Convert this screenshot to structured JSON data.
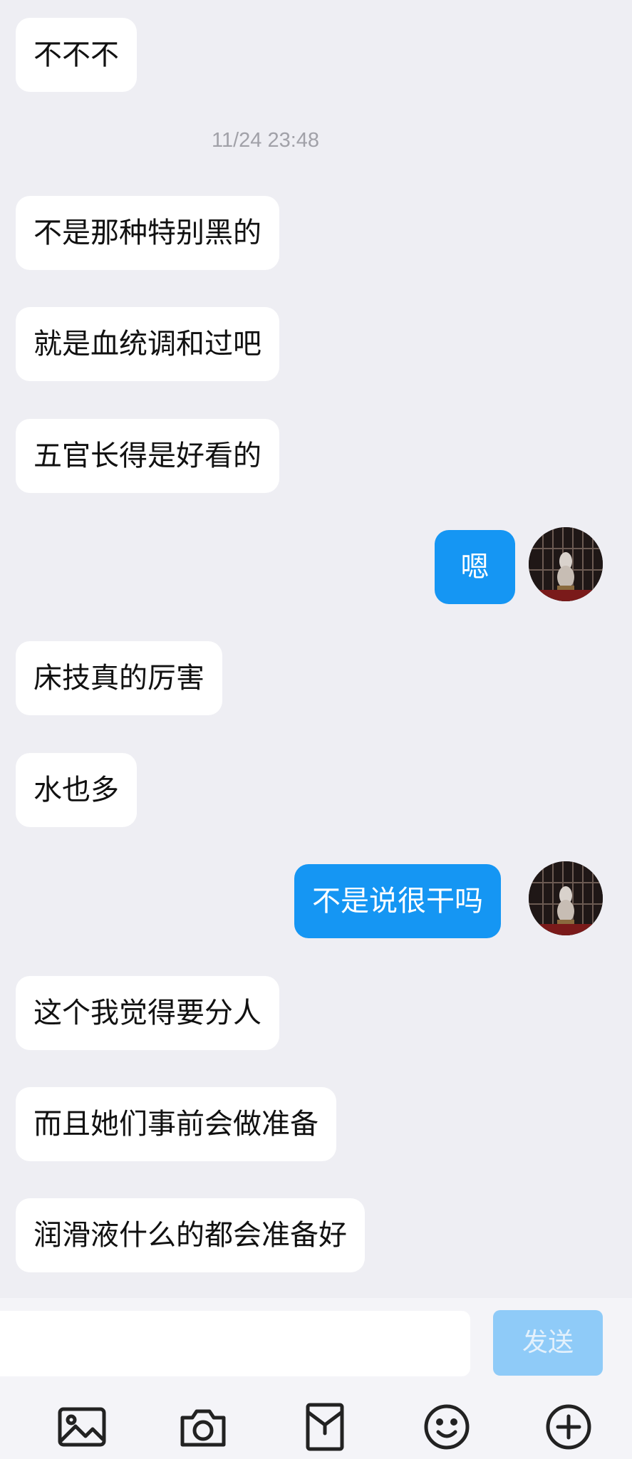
{
  "timestamp": "11/24 23:48",
  "messages": [
    {
      "dir": "in",
      "text": "不不不"
    },
    {
      "dir": "in",
      "text": "不是那种特别黑的"
    },
    {
      "dir": "in",
      "text": "就是血统调和过吧"
    },
    {
      "dir": "in",
      "text": "五官长得是好看的"
    },
    {
      "dir": "out",
      "text": "嗯"
    },
    {
      "dir": "in",
      "text": "床技真的厉害"
    },
    {
      "dir": "in",
      "text": "水也多"
    },
    {
      "dir": "out",
      "text": "不是说很干吗"
    },
    {
      "dir": "in",
      "text": "这个我觉得要分人"
    },
    {
      "dir": "in",
      "text": "而且她们事前会做准备"
    },
    {
      "dir": "in",
      "text": "润滑液什么的都会准备好"
    }
  ],
  "composer": {
    "input_value": "",
    "send_label": "发送"
  },
  "toolbar": {
    "icons": [
      "image-icon",
      "camera-icon",
      "red-packet-icon",
      "emoji-icon",
      "plus-icon"
    ]
  },
  "colors": {
    "background": "#eeeef3",
    "incoming_bubble": "#ffffff",
    "outgoing_bubble": "#1596f3",
    "send_button_disabled": "#8fcbf8"
  }
}
